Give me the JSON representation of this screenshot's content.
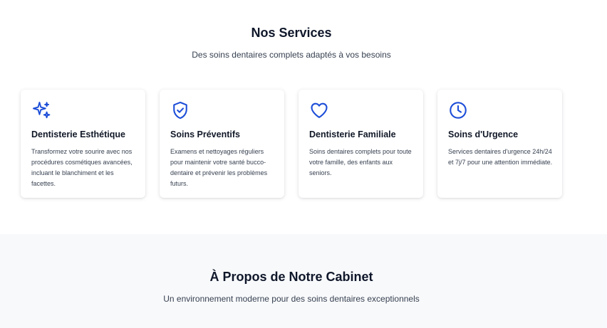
{
  "services": {
    "title": "Nos Services",
    "subtitle": "Des soins dentaires complets adaptés à vos besoins",
    "cards": [
      {
        "icon": "sparkles-icon",
        "title": "Dentisterie Esthétique",
        "description": "Transformez votre sourire avec nos procédures cosmétiques avancées, incluant le blanchiment et les facettes."
      },
      {
        "icon": "shield-check-icon",
        "title": "Soins Préventifs",
        "description": "Examens et nettoyages réguliers pour maintenir votre santé bucco-dentaire et prévenir les problèmes futurs."
      },
      {
        "icon": "heart-icon",
        "title": "Dentisterie Familiale",
        "description": "Soins dentaires complets pour toute votre famille, des enfants aux seniors."
      },
      {
        "icon": "clock-icon",
        "title": "Soins d'Urgence",
        "description": "Services dentaires d'urgence 24h/24 et 7j/7 pour une attention immédiate."
      }
    ]
  },
  "about": {
    "title": "À Propos de Notre Cabinet",
    "subtitle": "Un environnement moderne pour des soins dentaires exceptionnels"
  },
  "colors": {
    "accent": "#1d4ed8",
    "heading": "#0f172a",
    "about_background": "#f8f9fb"
  }
}
